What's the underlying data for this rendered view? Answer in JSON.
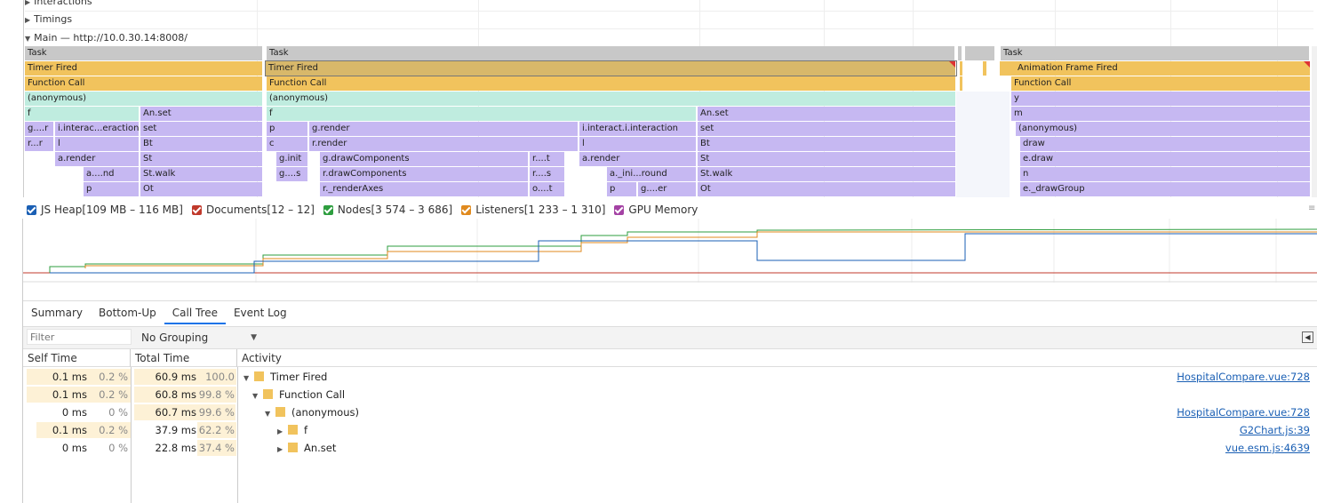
{
  "tracks": {
    "interactions": "Interactions",
    "timings": "Timings",
    "main": "Main — http://10.0.30.14:8008/"
  },
  "flame": {
    "task": "Task",
    "timer_fired": "Timer Fired",
    "function_call": "Function Call",
    "anonymous": "(anonymous)",
    "animation_frame_fired": "Animation Frame Fired",
    "col1": [
      "f",
      "g....r",
      "i.interac...eraction",
      "r...r",
      "l",
      "a.render",
      "a....nd",
      "p",
      "An.set",
      "set",
      "Bt",
      "St",
      "St.walk",
      "Ot"
    ],
    "col2": [
      "f",
      "p",
      "g.render",
      "c",
      "r.render",
      "g.init",
      "g.drawComponents",
      "r....t",
      "g....s",
      "r.drawComponents",
      "r....s",
      "r._renderAxes",
      "o....t",
      "i.interact.i.interaction",
      "l",
      "a.render",
      "a._ini...round",
      "p",
      "g....er",
      "An.set",
      "set",
      "Bt",
      "St",
      "St.walk",
      "Ot"
    ],
    "col3": [
      "y",
      "m",
      "(anonymous)",
      "draw",
      "e.draw",
      "n",
      "e._drawGroup"
    ]
  },
  "legend": [
    {
      "label": "JS Heap[109 MB – 116 MB]",
      "color": "#1a5fb4"
    },
    {
      "label": "Documents[12 – 12]",
      "color": "#c0392b"
    },
    {
      "label": "Nodes[3 574 – 3 686]",
      "color": "#2e9e3f"
    },
    {
      "label": "Listeners[1 233 – 1 310]",
      "color": "#e08a1e"
    },
    {
      "label": "GPU Memory",
      "color": "#a442a4"
    }
  ],
  "tabs": [
    "Summary",
    "Bottom-Up",
    "Call Tree",
    "Event Log"
  ],
  "active_tab": "Call Tree",
  "filter_placeholder": "Filter",
  "grouping": "No Grouping",
  "columns": {
    "self": "Self Time",
    "total": "Total Time",
    "activity": "Activity"
  },
  "rows": [
    {
      "self": "0.1 ms",
      "self_pct": "0.2 %",
      "total": "60.9 ms",
      "total_pct": "100.0 %",
      "activity": "Timer Fired",
      "source": "HospitalCompare.vue:728"
    },
    {
      "self": "0.1 ms",
      "self_pct": "0.2 %",
      "total": "60.8 ms",
      "total_pct": "99.8 %",
      "activity": "Function Call",
      "source": ""
    },
    {
      "self": "0 ms",
      "self_pct": "0 %",
      "total": "60.7 ms",
      "total_pct": "99.6 %",
      "activity": "(anonymous)",
      "source": "HospitalCompare.vue:728"
    },
    {
      "self": "0.1 ms",
      "self_pct": "0.2 %",
      "total": "37.9 ms",
      "total_pct": "62.2 %",
      "activity": "f",
      "source": "G2Chart.js:39"
    },
    {
      "self": "0 ms",
      "self_pct": "0 %",
      "total": "22.8 ms",
      "total_pct": "37.4 %",
      "activity": "An.set",
      "source": "vue.esm.js:4639"
    }
  ]
}
